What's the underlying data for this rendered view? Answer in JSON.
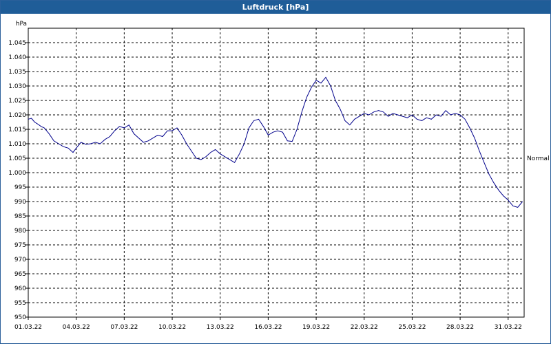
{
  "window": {
    "title": "Luftdruck [hPa]"
  },
  "chart_data": {
    "type": "line",
    "title": "Luftdruck [hPa]",
    "ylabel": "hPa",
    "xlabel": "",
    "ylim": [
      950,
      1050
    ],
    "yticks": [
      950,
      955,
      960,
      965,
      970,
      975,
      980,
      985,
      990,
      995,
      1000,
      1005,
      1010,
      1015,
      1020,
      1025,
      1030,
      1035,
      1040,
      1045
    ],
    "ytick_labels": [
      "950",
      "955",
      "960",
      "965",
      "970",
      "975",
      "980",
      "985",
      "990",
      "995",
      "1.000",
      "1.005",
      "1.010",
      "1.015",
      "1.020",
      "1.025",
      "1.030",
      "1.035",
      "1.040",
      "1.045"
    ],
    "xlim": [
      1,
      32
    ],
    "xticks": [
      1,
      4,
      7,
      10,
      13,
      16,
      19,
      22,
      25,
      28,
      31
    ],
    "xtick_labels": [
      "01.03.22",
      "04.03.22",
      "07.03.22",
      "10.03.22",
      "13.03.22",
      "16.03.22",
      "19.03.22",
      "22.03.22",
      "25.03.22",
      "28.03.22",
      "31.03.22"
    ],
    "reference_line": {
      "label": "Normal",
      "y": 1005
    },
    "grid": true,
    "line_color": "#00008b",
    "series": [
      {
        "x": [
          1.0,
          1.2,
          1.4,
          1.6,
          1.8,
          2.0,
          2.3,
          2.6,
          2.9,
          3.2,
          3.5,
          3.8,
          4.0,
          4.3,
          4.6,
          4.9,
          5.2,
          5.5,
          5.8,
          6.1,
          6.4,
          6.7,
          7.0,
          7.3,
          7.6,
          7.9,
          8.2,
          8.5,
          8.8,
          9.1,
          9.4,
          9.7,
          10.0,
          10.3,
          10.6,
          10.9,
          11.2,
          11.5,
          11.8,
          12.1,
          12.4,
          12.7,
          13.0,
          13.3,
          13.6,
          13.9,
          14.2,
          14.5,
          14.8,
          15.1,
          15.4,
          15.7,
          16.0,
          16.3,
          16.6,
          16.9,
          17.2,
          17.5,
          17.8,
          18.1,
          18.4,
          18.7,
          19.0,
          19.3,
          19.6,
          19.9,
          20.2,
          20.5,
          20.8,
          21.1,
          21.4,
          21.7,
          22.0,
          22.3,
          22.6,
          22.9,
          23.2,
          23.5,
          23.8,
          24.1,
          24.4,
          24.7,
          25.0,
          25.3,
          25.6,
          25.9,
          26.2,
          26.5,
          26.8,
          27.1,
          27.4,
          27.7,
          28.0,
          28.3,
          28.6,
          28.9,
          29.2,
          29.5,
          29.8,
          30.1,
          30.4,
          30.7,
          31.0,
          31.3,
          31.6,
          31.9
        ],
        "y": [
          1018.5,
          1018.8,
          1017.5,
          1016.8,
          1016.0,
          1015.5,
          1013.5,
          1011.0,
          1010.0,
          1009.0,
          1008.5,
          1007.0,
          1008.5,
          1010.5,
          1009.8,
          1010.0,
          1010.5,
          1010.0,
          1011.5,
          1012.5,
          1014.5,
          1016.0,
          1015.5,
          1016.5,
          1013.5,
          1012.0,
          1010.5,
          1011.0,
          1012.0,
          1013.0,
          1012.5,
          1014.5,
          1014.5,
          1015.5,
          1013.0,
          1010.0,
          1007.5,
          1005.0,
          1004.5,
          1005.5,
          1007.0,
          1008.0,
          1006.5,
          1005.5,
          1004.5,
          1003.5,
          1006.5,
          1010.0,
          1015.5,
          1018.0,
          1018.5,
          1016.0,
          1013.0,
          1014.0,
          1014.5,
          1014.0,
          1011.0,
          1010.8,
          1015.0,
          1021.0,
          1026.0,
          1029.5,
          1032.0,
          1031.0,
          1033.0,
          1030.0,
          1025.0,
          1022.0,
          1018.0,
          1016.5,
          1018.5,
          1019.5,
          1020.5,
          1020.0,
          1021.0,
          1021.5,
          1021.0,
          1019.5,
          1020.5,
          1020.0,
          1019.5,
          1019.0,
          1020.0,
          1018.5,
          1018.0,
          1019.0,
          1018.5,
          1020.0,
          1019.5,
          1021.5,
          1020.0,
          1020.5,
          1020.0,
          1018.5,
          1015.5,
          1012.0,
          1007.5,
          1003.5,
          999.5,
          996.5,
          994.0,
          992.0,
          990.5,
          988.5,
          988.0,
          990.0
        ]
      }
    ]
  }
}
